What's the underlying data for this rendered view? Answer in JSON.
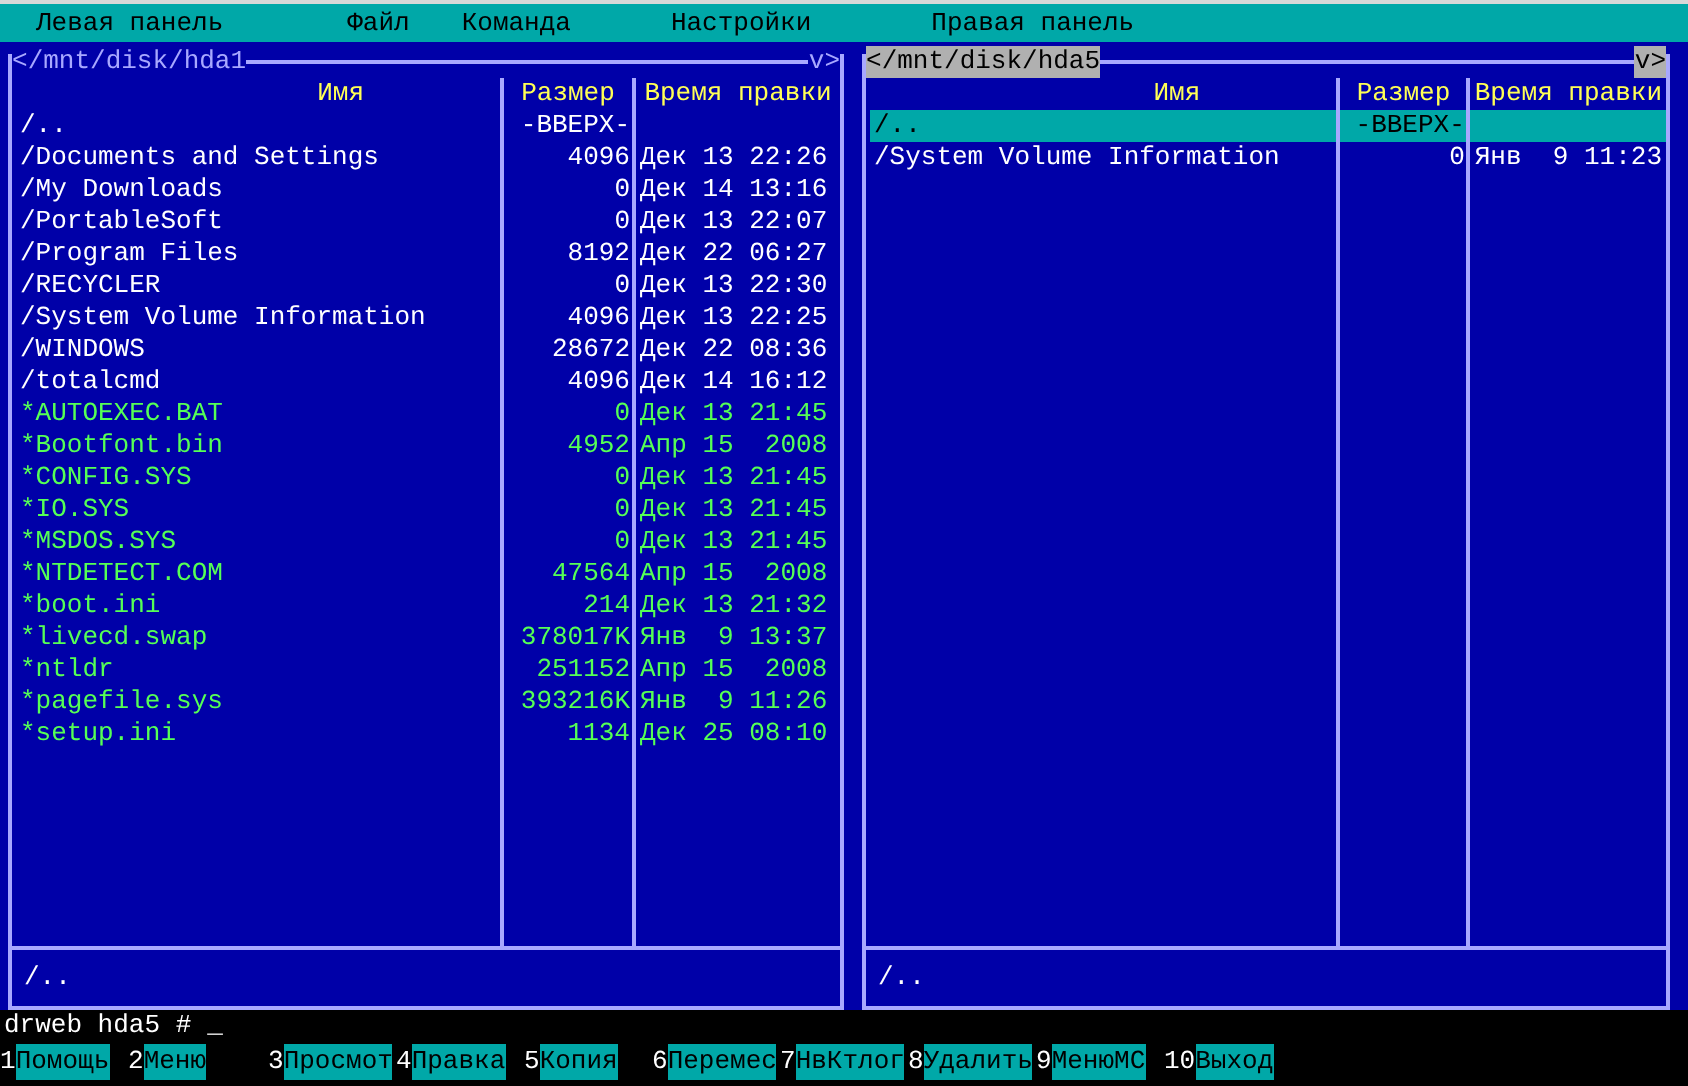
{
  "menu_bar": [
    "Левая панель",
    "Файл",
    "Команда",
    "Настройки",
    "Правая панель"
  ],
  "panels": [
    {
      "active": false,
      "nav_left": "<",
      "path": "/mnt/disk/hda1",
      "nav_right": "v>",
      "columns": [
        "Имя",
        "Размер",
        "Время правки"
      ],
      "mini_status": "/..",
      "rows": [
        {
          "kind": "dir",
          "name": "/..",
          "size": "-ВВЕРХ-",
          "modified": "",
          "selected": false
        },
        {
          "kind": "dir",
          "name": "/Documents and Settings",
          "size": "4096",
          "modified": "Дек 13 22:26",
          "selected": false
        },
        {
          "kind": "dir",
          "name": "/My Downloads",
          "size": "0",
          "modified": "Дек 14 13:16",
          "selected": false
        },
        {
          "kind": "dir",
          "name": "/PortableSoft",
          "size": "0",
          "modified": "Дек 13 22:07",
          "selected": false
        },
        {
          "kind": "dir",
          "name": "/Program Files",
          "size": "8192",
          "modified": "Дек 22 06:27",
          "selected": false
        },
        {
          "kind": "dir",
          "name": "/RECYCLER",
          "size": "0",
          "modified": "Дек 13 22:30",
          "selected": false
        },
        {
          "kind": "dir",
          "name": "/System Volume Information",
          "size": "4096",
          "modified": "Дек 13 22:25",
          "selected": false
        },
        {
          "kind": "dir",
          "name": "/WINDOWS",
          "size": "28672",
          "modified": "Дек 22 08:36",
          "selected": false
        },
        {
          "kind": "dir",
          "name": "/totalcmd",
          "size": "4096",
          "modified": "Дек 14 16:12",
          "selected": false
        },
        {
          "kind": "file",
          "name": "*AUTOEXEC.BAT",
          "size": "0",
          "modified": "Дек 13 21:45",
          "selected": false
        },
        {
          "kind": "file",
          "name": "*Bootfont.bin",
          "size": "4952",
          "modified": "Апр 15  2008",
          "selected": false
        },
        {
          "kind": "file",
          "name": "*CONFIG.SYS",
          "size": "0",
          "modified": "Дек 13 21:45",
          "selected": false
        },
        {
          "kind": "file",
          "name": "*IO.SYS",
          "size": "0",
          "modified": "Дек 13 21:45",
          "selected": false
        },
        {
          "kind": "file",
          "name": "*MSDOS.SYS",
          "size": "0",
          "modified": "Дек 13 21:45",
          "selected": false
        },
        {
          "kind": "file",
          "name": "*NTDETECT.COM",
          "size": "47564",
          "modified": "Апр 15  2008",
          "selected": false
        },
        {
          "kind": "file",
          "name": "*boot.ini",
          "size": "214",
          "modified": "Дек 13 21:32",
          "selected": false
        },
        {
          "kind": "file",
          "name": "*livecd.swap",
          "size": "378017K",
          "modified": "Янв  9 13:37",
          "selected": false
        },
        {
          "kind": "file",
          "name": "*ntldr",
          "size": "251152",
          "modified": "Апр 15  2008",
          "selected": false
        },
        {
          "kind": "file",
          "name": "*pagefile.sys",
          "size": "393216K",
          "modified": "Янв  9 11:26",
          "selected": false
        },
        {
          "kind": "file",
          "name": "*setup.ini",
          "size": "1134",
          "modified": "Дек 25 08:10",
          "selected": false
        }
      ]
    },
    {
      "active": true,
      "nav_left": "<",
      "path": "/mnt/disk/hda5",
      "nav_right": "v>",
      "columns": [
        "Имя",
        "Размер",
        "Время правки"
      ],
      "mini_status": "/..",
      "rows": [
        {
          "kind": "dir",
          "name": "/..",
          "size": "-ВВЕРХ-",
          "modified": "",
          "selected": true
        },
        {
          "kind": "dir",
          "name": "/System Volume Information",
          "size": "0",
          "modified": "Янв  9 11:23",
          "selected": false
        }
      ]
    }
  ],
  "command_line": {
    "prompt": "drweb hda5 #",
    "cursor": "_"
  },
  "key_bar": [
    {
      "key": "1",
      "label": "Помощь"
    },
    {
      "key": "2",
      "label": "Меню"
    },
    {
      "key": "3",
      "label": "Просмот"
    },
    {
      "key": "4",
      "label": "Правка"
    },
    {
      "key": "5",
      "label": "Копия"
    },
    {
      "key": "6",
      "label": "Перемес"
    },
    {
      "key": "7",
      "label": "НвКтлог"
    },
    {
      "key": "8",
      "label": "Удалить"
    },
    {
      "key": "9",
      "label": "МенюМС"
    },
    {
      "key": "10",
      "label": "Выход"
    }
  ]
}
